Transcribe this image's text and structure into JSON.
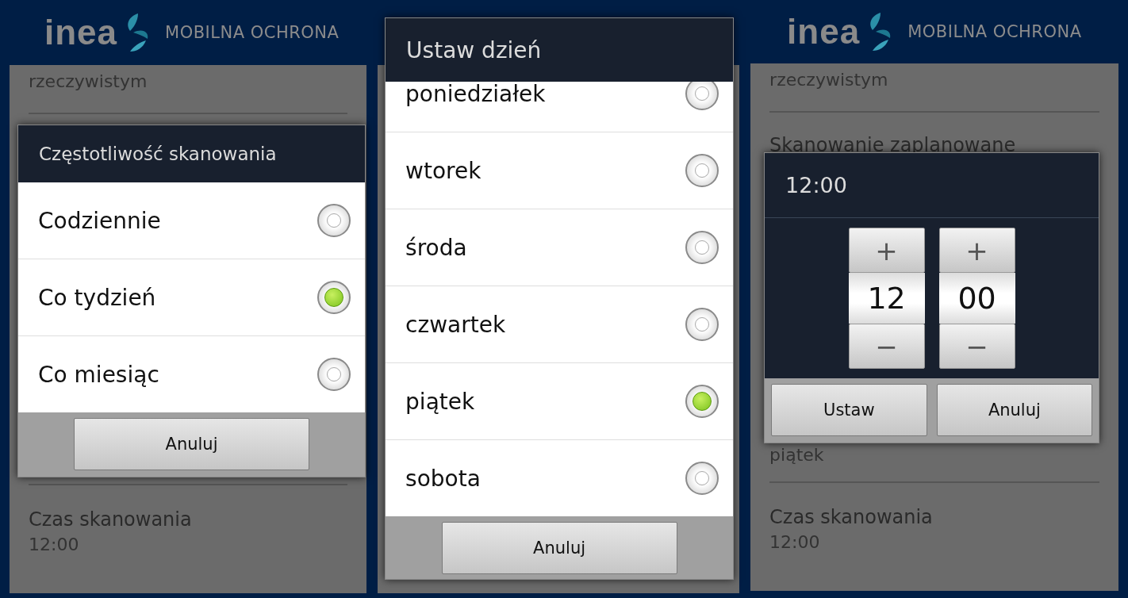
{
  "screens": [
    {
      "kind": "choice",
      "header": {
        "brand": "inea",
        "title": "MOBILNA OCHRONA"
      },
      "background": {
        "top": [
          {
            "kind": "summary",
            "text": "rzeczywistym"
          }
        ],
        "bottom": [
          {
            "kind": "title",
            "text": "Czas skanowania"
          },
          {
            "kind": "summary",
            "text": "12:00"
          }
        ]
      },
      "dialog": {
        "title": "Częstotliwość skanowania",
        "options": [
          {
            "label": "Codziennie",
            "selected": false
          },
          {
            "label": "Co tydzień",
            "selected": true
          },
          {
            "label": "Co miesiąc",
            "selected": false
          }
        ],
        "buttons": [
          "Anuluj"
        ]
      }
    },
    {
      "kind": "choice",
      "dialog": {
        "title": "Ustaw dzień",
        "options": [
          {
            "label": "poniedziałek",
            "selected": false
          },
          {
            "label": "wtorek",
            "selected": false
          },
          {
            "label": "środa",
            "selected": false
          },
          {
            "label": "czwartek",
            "selected": false
          },
          {
            "label": "piątek",
            "selected": true
          },
          {
            "label": "sobota",
            "selected": false
          }
        ],
        "buttons": [
          "Anuluj"
        ]
      }
    },
    {
      "kind": "time",
      "header": {
        "brand": "inea",
        "title": "MOBILNA OCHRONA"
      },
      "background": {
        "top": [
          {
            "kind": "summary",
            "text": "rzeczywistym"
          },
          {
            "kind": "title",
            "text": "Skanowanie zaplanowane"
          }
        ],
        "bottom": [
          {
            "kind": "summary",
            "text": "piątek"
          },
          {
            "kind": "title",
            "text": "Czas skanowania"
          },
          {
            "kind": "summary",
            "text": "12:00"
          }
        ]
      },
      "dialog": {
        "title": "12:00",
        "fields": [
          {
            "increment": "+",
            "value": "12",
            "decrement": "−"
          },
          {
            "increment": "+",
            "value": "00",
            "decrement": "−"
          }
        ],
        "buttons": [
          "Ustaw",
          "Anuluj"
        ]
      }
    }
  ]
}
